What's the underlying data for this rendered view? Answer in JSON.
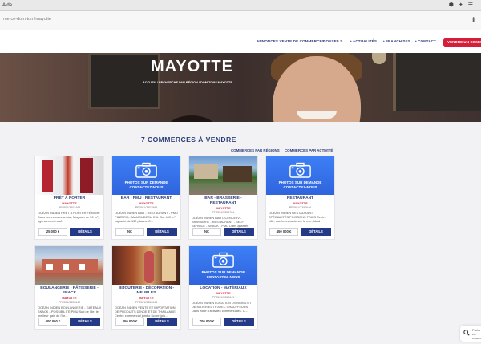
{
  "browser": {
    "menu_label": "Aide",
    "url": "merce-dom-tom/mayotte"
  },
  "nav": {
    "items": [
      "ANNONCES VENTE DE COMMERCES",
      "CONSEILS",
      "ACTUALITÉS",
      "FRANCHISES",
      "CONTACT"
    ],
    "cta": "VENDRE UN COMMERCE"
  },
  "hero": {
    "title": "MAYOTTE",
    "breadcrumb": "ACCUEIL / RECHERCHE PAR RÉGION / DOM-TOM / MAYOTTE"
  },
  "results": {
    "count_title": "7 COMMERCES À VENDRE",
    "filters": [
      "COMMERCES PAR RÉGIONS",
      "COMMERCES PAR ACTIVITÉ"
    ]
  },
  "photo_placeholder": "PHOTOS SUR DEMANDE CONTACTEZ-NOUS",
  "details_label": "DÉTAILS",
  "listings": [
    {
      "title": "PRÊT À PORTER",
      "region": "MAYOTTE",
      "ref": "PF0501/3403494",
      "desc": "OCÉAN INDIEN PRÊT À PORTER FÉMININ Dans centre commercial, Magasin de 50 m², agencement neuf.",
      "price": "25 000 €",
      "photo": "clothing"
    },
    {
      "title": "BAR - PMU - RESTAURANT",
      "region": "MAYOTTE",
      "ref": "PF0501/3403969",
      "desc": "OCÉAN INDIEN BAR - RESTAURANT - PMU PIZZERIA - MAMOUDZOU C.A. Sur 400 m², capacité de 130 places. C...",
      "price": "NC",
      "photo": "placeholder"
    },
    {
      "title": "BAR - BRASSERIE - RESTAURANT",
      "region": "MAYOTTE",
      "ref": "PF0501/3350764",
      "desc": "OCÉAN INDIEN BAR LICENCE IV - BRASSERIE - RESTAURANT - SELF SERVICE - SNACK - PMU Dans quartier",
      "price": "NC",
      "photo": "terrace"
    },
    {
      "title": "RESTAURANT",
      "region": "MAYOTTE",
      "ref": "PF0501/3350646",
      "desc": "OCÉAN INDIEN RESTAURANT SPÉCIALITÉS POISSONS FRAIS Centre ville, vue imprenable sur la mer, Idéal",
      "price": "450 000 €",
      "photo": "placeholder"
    },
    {
      "title": "BOULANGERIE - PÂTISSERIE - SNACK",
      "region": "MAYOTTE",
      "ref": "PF0501/3350647",
      "desc": "OCÉAN INDIEN BOULANGERIE - GÂTEAUX SNACK - POSSIBILITÉ PMU Sud de l'île, le meilleur pain de l'île...",
      "price": "400 000 €",
      "photo": "building"
    },
    {
      "title": "BIJOUTERIE - DÉCORATION - MEUBLES",
      "region": "MAYOTTE",
      "ref": "PF0501/3350648",
      "desc": "OCÉAN INDIEN VENTE ET IMPORTATION DE PRODUITS D'INDE ET DE THAILANDE Centre commercial jumbo Score (plu...",
      "price": "350 000 €",
      "photo": "shop"
    },
    {
      "title": "LOCATION - MATÉRIAUX",
      "region": "MAYOTTE",
      "ref": "PF0501/3350649",
      "desc": "OCÉAN INDIEN LOCATION D'ENGINS ET DE MATÉRIEL TP AVEC CHAUFFEURS Dans zone d'activités commerciales. C...",
      "price": "700 000 €",
      "photo": "placeholder"
    }
  ],
  "chat": {
    "text": "Parlons-en ensemble"
  }
}
